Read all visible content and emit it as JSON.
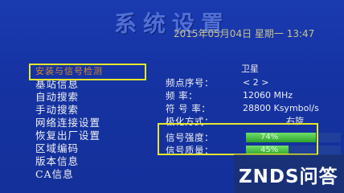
{
  "header": {
    "title": "系统设置",
    "datetime": "2015年05月04日  星期一  13:47"
  },
  "sidebar": {
    "items": [
      {
        "label": "安装与信号检测",
        "active": true
      },
      {
        "label": "基站信息"
      },
      {
        "label": "自动搜索"
      },
      {
        "label": "手动搜索"
      },
      {
        "label": "网络连接设置"
      },
      {
        "label": "恢复出厂设置"
      },
      {
        "label": "区域编码"
      },
      {
        "label": "版本信息"
      },
      {
        "label": "CA信息"
      }
    ]
  },
  "panel": {
    "satellite": "卫星",
    "rows": [
      {
        "label": "频点序号：",
        "value": "<   2   >"
      },
      {
        "label": "频      率：",
        "value": "12060 MHz"
      },
      {
        "label": "符  号  率：",
        "value": "28800 Ksymbol/s"
      },
      {
        "label": "极化方式：",
        "value": "右旋"
      }
    ],
    "signal_strength": {
      "label": "信号强度：",
      "percent": 74,
      "text": "74%"
    },
    "signal_quality": {
      "label": "信号质量：",
      "percent": 45,
      "text": "45%"
    }
  },
  "watermark": {
    "text": "ZNDS问答"
  },
  "colors": {
    "highlight": "#e8e62a",
    "bar_fill": "#3fc23c",
    "active_menu": "#d78a2a"
  }
}
